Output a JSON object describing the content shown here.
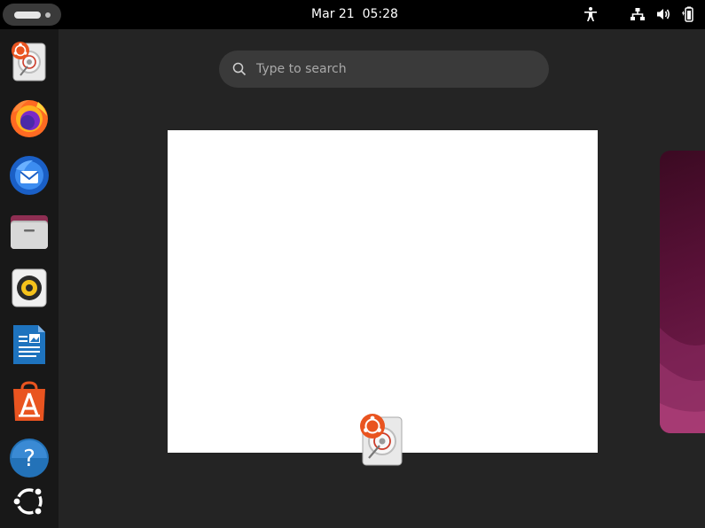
{
  "topbar": {
    "clock": "Mar 21  05:28",
    "tray_icons": [
      "accessibility-icon",
      "network-icon",
      "volume-icon",
      "battery-icon"
    ]
  },
  "dock": {
    "items": [
      {
        "name": "dock-item-disk-usage",
        "icon": "disk-usage-icon"
      },
      {
        "name": "dock-item-firefox",
        "icon": "firefox-icon"
      },
      {
        "name": "dock-item-thunderbird",
        "icon": "thunderbird-icon"
      },
      {
        "name": "dock-item-files",
        "icon": "files-icon"
      },
      {
        "name": "dock-item-rhythmbox",
        "icon": "rhythmbox-icon"
      },
      {
        "name": "dock-item-writer",
        "icon": "writer-icon"
      },
      {
        "name": "dock-item-app-center",
        "icon": "app-center-icon"
      },
      {
        "name": "dock-item-help",
        "icon": "help-icon"
      },
      {
        "name": "dock-item-show-apps",
        "icon": "ubuntu-logo-icon"
      }
    ]
  },
  "search": {
    "placeholder": "Type to search"
  },
  "overview": {
    "window_app_icon": "disk-usage-icon"
  },
  "colors": {
    "ubuntu_orange": "#e95420",
    "workspace_bg": "#5a1138",
    "panel": "#000000",
    "dock": "#181818"
  }
}
